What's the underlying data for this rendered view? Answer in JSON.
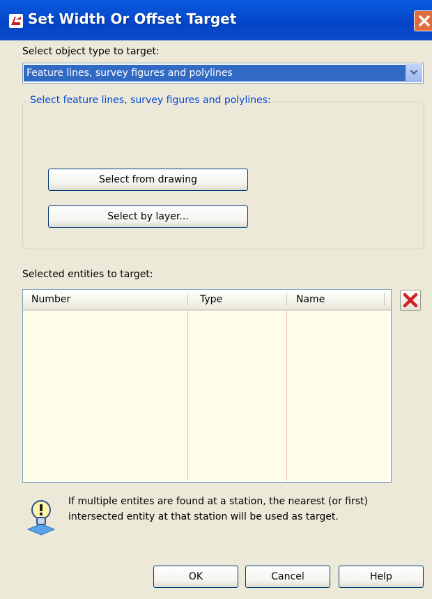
{
  "window": {
    "title": "Set Width Or Offset Target",
    "title_icon": "civil-app-icon",
    "close_icon": "close-icon",
    "colors": {
      "titlebar": "#0A5ADF",
      "close": "#E06B3D",
      "background": "#ECE9D8",
      "selection": "#316AC5",
      "group_label": "#0046D5"
    }
  },
  "object_type": {
    "label": "Select object type to target:",
    "selected": "Feature lines, survey figures and polylines",
    "arrow_icon": "chevron-down-icon"
  },
  "selection_group": {
    "legend": "Select feature lines, survey figures and polylines:",
    "select_from_drawing": "Select from drawing",
    "select_by_layer": "Select by layer..."
  },
  "entities": {
    "label": "Selected entities to target:",
    "columns": [
      "Number",
      "Type",
      "Name"
    ],
    "rows": [],
    "delete_icon": "delete-x-icon"
  },
  "info": {
    "icon": "lightbulb-icon",
    "text": "If multiple entites are found at a station, the nearest (or first) intersected entity at that station will be used as target."
  },
  "buttons": {
    "ok": "OK",
    "cancel": "Cancel",
    "help": "Help"
  }
}
